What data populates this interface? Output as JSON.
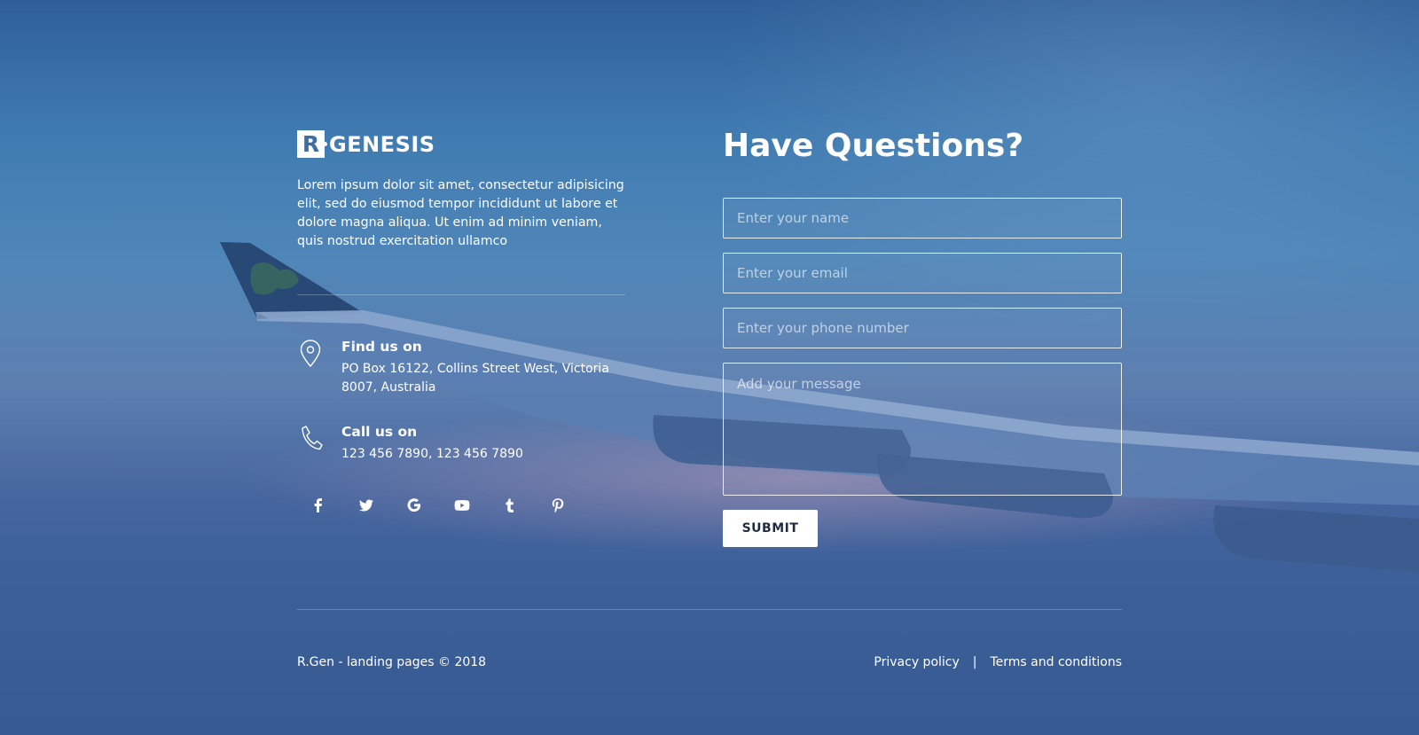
{
  "brand": {
    "mark": "R",
    "name": "GENESIS"
  },
  "intro_text": "Lorem ipsum dolor sit amet, consectetur adipisicing elit, sed do eiusmod tempor incididunt ut labore et dolore magna aliqua. Ut enim ad minim veniam, quis nostrud exercitation ullamco",
  "contact": {
    "address_title": "Find us on",
    "address_text": "PO Box 16122, Collins Street West, Victoria 8007, Australia",
    "phone_title": "Call us on",
    "phone_text": "123 456 7890, 123 456 7890"
  },
  "socials": [
    {
      "icon": "facebook-icon"
    },
    {
      "icon": "twitter-icon"
    },
    {
      "icon": "google-icon"
    },
    {
      "icon": "youtube-icon"
    },
    {
      "icon": "tumblr-icon"
    },
    {
      "icon": "pinterest-icon"
    }
  ],
  "form": {
    "title": "Have Questions?",
    "name_placeholder": "Enter your name",
    "email_placeholder": "Enter your email",
    "phone_placeholder": "Enter your phone number",
    "message_placeholder": "Add your message",
    "submit_label": "SUBMIT"
  },
  "footer": {
    "copyright": "R.Gen - landing pages © 2018",
    "privacy": "Privacy policy",
    "separator": "|",
    "terms": "Terms and conditions"
  },
  "colors": {
    "background": "#4a7db3",
    "text": "#ffffff",
    "button_bg": "#ffffff",
    "button_text": "#1f2c40"
  }
}
